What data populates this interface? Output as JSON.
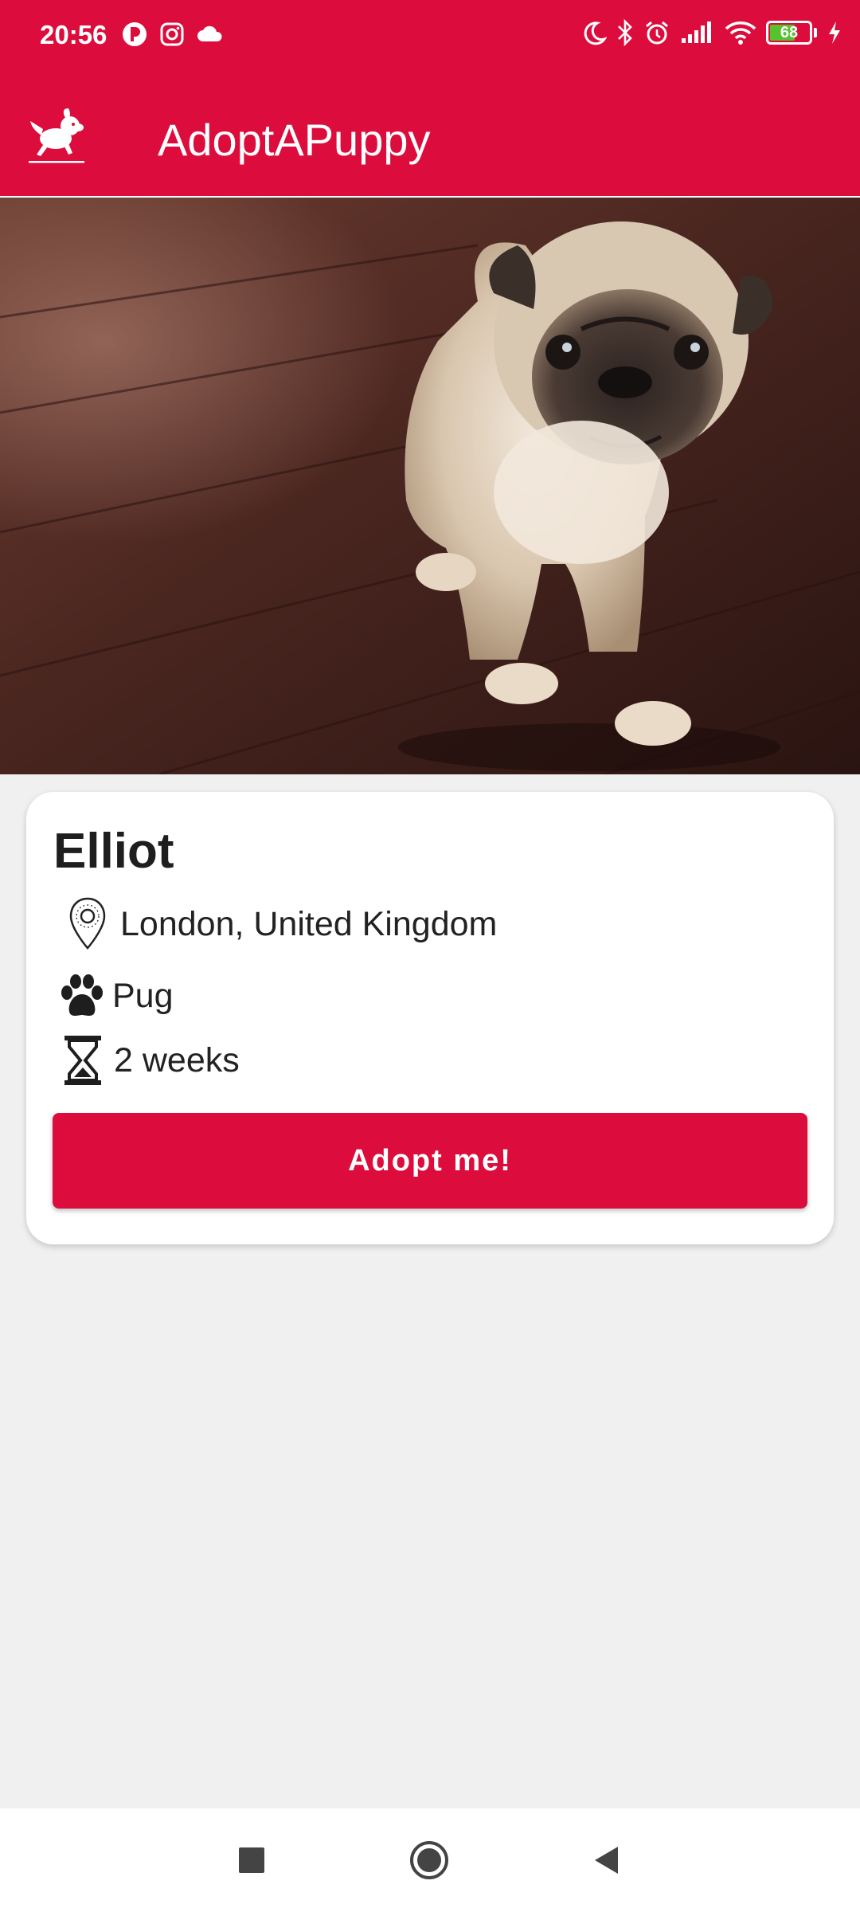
{
  "status_bar": {
    "time": "20:56",
    "battery_level": 68,
    "battery_label": "68",
    "left_icons": [
      "vpn-icon",
      "instagram-icon",
      "cloud-icon"
    ],
    "right_icons": [
      "moon-icon",
      "bluetooth-icon",
      "alarm-icon",
      "signal-icon",
      "wifi-icon",
      "battery-icon",
      "charging-icon"
    ]
  },
  "app_bar": {
    "title": "AdoptAPuppy",
    "logo_icon": "puppy-logo-icon"
  },
  "hero": {
    "image_subject": "pug puppy standing on wooden floor"
  },
  "pet": {
    "name": "Elliot",
    "location": "London, United Kingdom",
    "breed": "Pug",
    "age": "2 weeks",
    "location_icon": "location-pin-icon",
    "breed_icon": "paw-icon",
    "age_icon": "hourglass-icon"
  },
  "actions": {
    "adopt_label": "Adopt me!"
  },
  "nav": {
    "items": [
      "recents-button",
      "home-button",
      "back-button"
    ]
  },
  "colors": {
    "brand": "#dc0d3c",
    "background": "#f0f0f0",
    "card": "#ffffff",
    "battery_fill": "#56c22e"
  }
}
